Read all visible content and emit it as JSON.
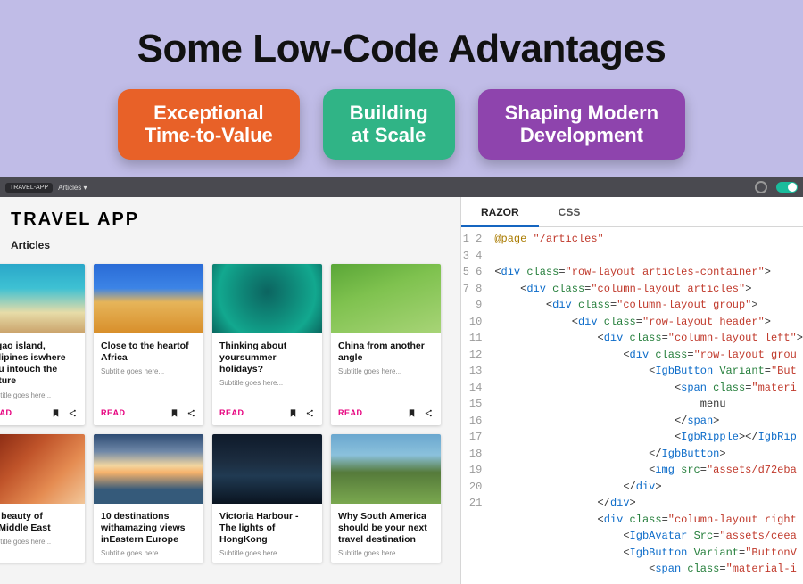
{
  "headline": "Some Low-Code Advantages",
  "pills": {
    "a": {
      "l1": "Exceptional",
      "l2": "Time-to-Value"
    },
    "b": {
      "l1": "Building",
      "l2": "at Scale"
    },
    "c": {
      "l1": "Shaping Modern",
      "l2": "Development"
    }
  },
  "designer_bar": {
    "badge": "TRAVEL-APP",
    "menu": "Articles ▾"
  },
  "travel": {
    "title": "TRAVEL APP",
    "section": "Articles",
    "read_label": "READ",
    "cards": [
      {
        "title": "argao island, hillipines iswhere you intouch the nature",
        "sub": "Subtitle goes here..."
      },
      {
        "title": "Close to the heartof Africa",
        "sub": "Subtitle goes here..."
      },
      {
        "title": "Thinking about yoursummer holidays?",
        "sub": "Subtitle goes here..."
      },
      {
        "title": "China from another angle",
        "sub": "Subtitle goes here..."
      },
      {
        "title": "he beauty of heMiddle East",
        "sub": "Subtitle goes here..."
      },
      {
        "title": "10 destinations withamazing views inEastern Europe",
        "sub": "Subtitle goes here..."
      },
      {
        "title": "Victoria Harbour - The lights of HongKong",
        "sub": "Subtitle goes here..."
      },
      {
        "title": "Why South America should be your next travel destination",
        "sub": "Subtitle goes here..."
      }
    ]
  },
  "editor": {
    "tabs": {
      "razor": "RAZOR",
      "css": "CSS",
      "active": "razor"
    },
    "code": {
      "page_directive": "@page",
      "page_route": "\"/articles\"",
      "cls_articles_container": "\"row-layout articles-container\"",
      "cls_column_articles": "\"column-layout articles\"",
      "cls_column_group": "\"column-layout group\"",
      "cls_row_header": "\"row-layout header\"",
      "cls_column_left": "\"column-layout left\"",
      "cls_row_grou": "\"row-layout grou",
      "igb_button": "IgbButton",
      "variant_attr": "Variant",
      "variant_but": "\"But",
      "span_materi": "\"materi",
      "menu_text": "menu",
      "igb_ripple": "IgbRipple",
      "igb_rip_trunc": "IgbRip",
      "img_src": "\"assets/d72eba",
      "cls_column_right": "\"column-layout right",
      "igb_avatar": "IgbAvatar",
      "avatar_src": "\"assets/ceea",
      "variant_buttonv": "\"ButtonV",
      "span_material_i": "\"material-i",
      "line_count": 21
    }
  }
}
